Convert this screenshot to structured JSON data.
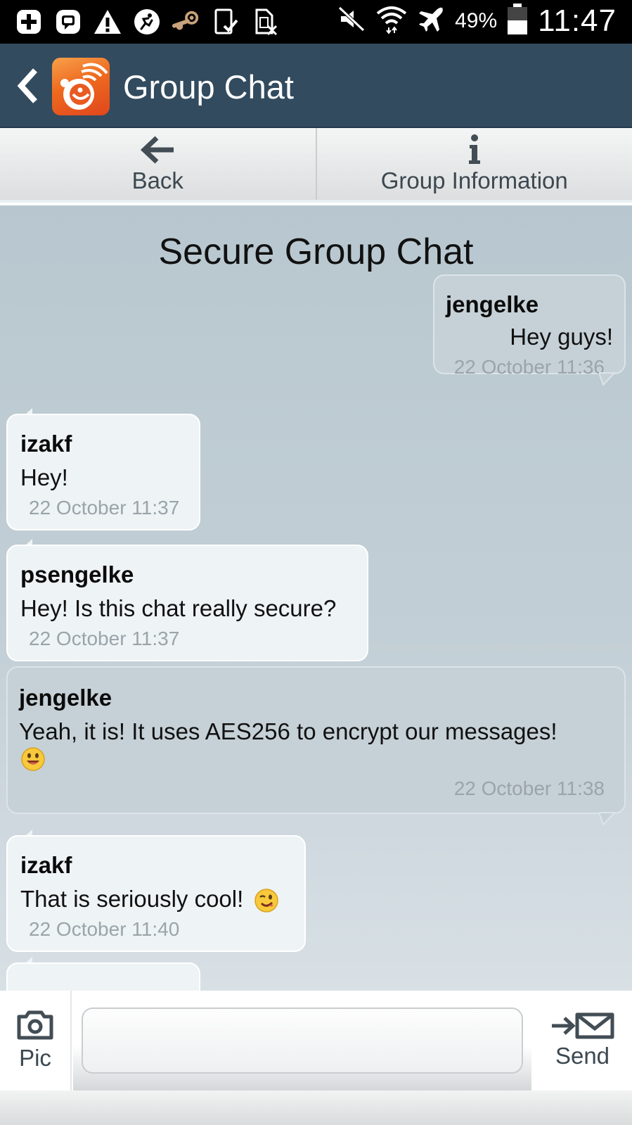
{
  "status_bar": {
    "battery_percent": "49%",
    "time": "11:47",
    "left_icons": [
      "add-box-icon",
      "chat-app-icon",
      "warning-icon",
      "sports-icon",
      "steam-icon",
      "tablet-check-icon",
      "sim-off-icon"
    ],
    "right_icons": [
      "mute-icon",
      "wifi-icon",
      "airplane-icon",
      "battery-icon"
    ]
  },
  "app_bar": {
    "title": "Group Chat"
  },
  "toolbar": {
    "back_label": "Back",
    "info_label": "Group Information"
  },
  "chat": {
    "title": "Secure Group Chat",
    "messages": [
      {
        "sender": "jengelke",
        "text": "Hey guys!",
        "time": "22 October 11:36",
        "direction": "outgoing"
      },
      {
        "sender": "izakf",
        "text": "Hey!",
        "time": "22 October 11:37",
        "direction": "incoming"
      },
      {
        "sender": "psengelke",
        "text": "Hey! Is this chat really secure?",
        "time": "22 October 11:37",
        "direction": "incoming"
      },
      {
        "sender": "jengelke",
        "text": "Yeah, it is! It uses AES256 to encrypt our messages!",
        "emoji": "grinning-face-emoji",
        "time": "22 October 11:38",
        "direction": "outgoing"
      },
      {
        "sender": "izakf",
        "text": "That is seriously cool!",
        "emoji": "winking-face-emoji",
        "time": "22 October 11:40",
        "direction": "incoming"
      }
    ]
  },
  "composer": {
    "pic_label": "Pic",
    "send_label": "Send",
    "input_value": ""
  },
  "colors": {
    "action_bar": "#324b5e",
    "chat_background": "#bfccd3",
    "bubble_incoming": "#eef3f5",
    "bubble_outgoing": "#c6d1d7",
    "timestamp": "#9aa4aa"
  }
}
